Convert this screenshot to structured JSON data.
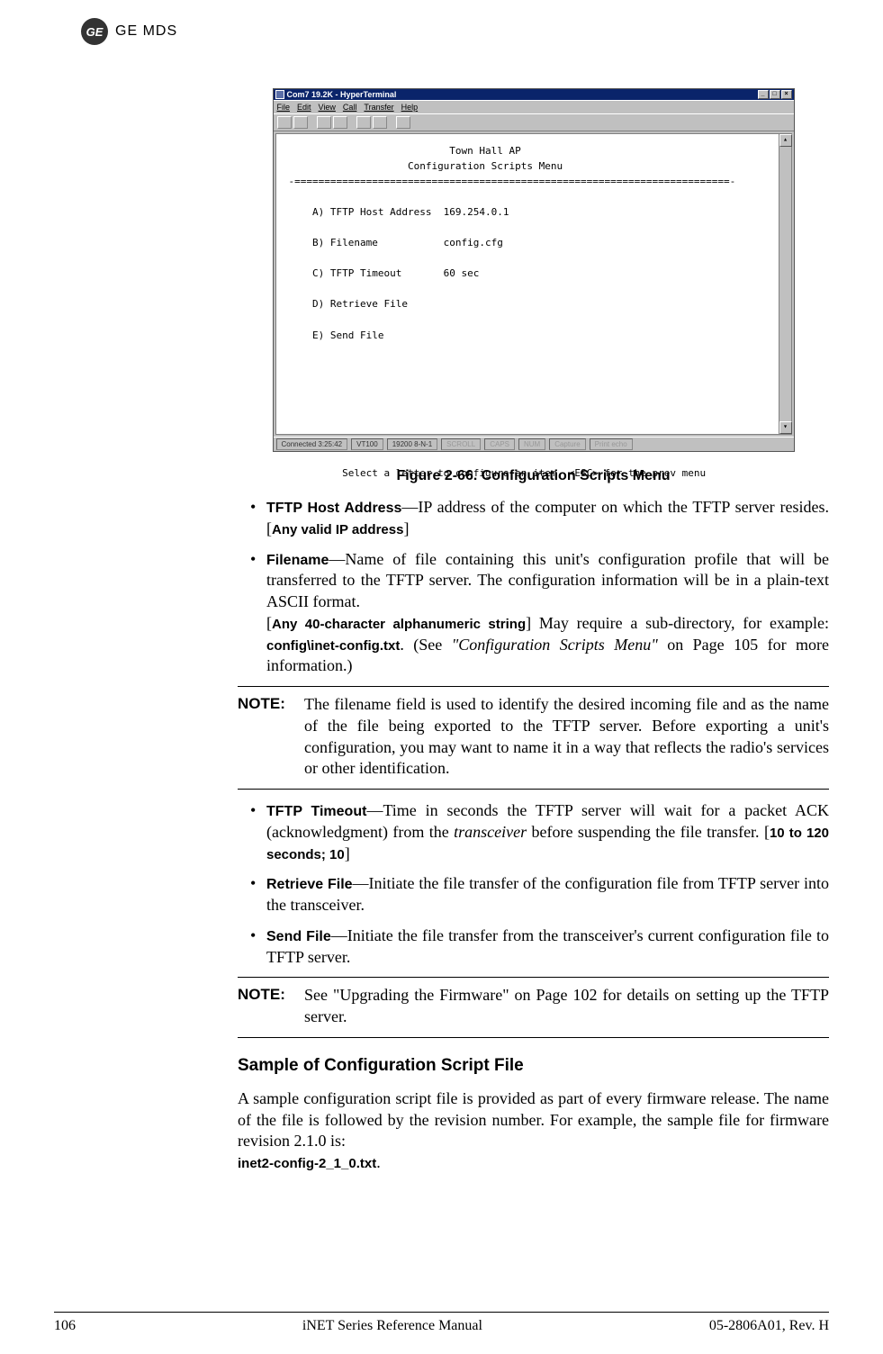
{
  "brand": {
    "ge": "GE",
    "mds": "MDS"
  },
  "screenshot": {
    "title": "Com7 19.2K - HyperTerminal",
    "menu": {
      "file": "File",
      "edit": "Edit",
      "view": "View",
      "call": "Call",
      "transfer": "Transfer",
      "help": "Help"
    },
    "terminal_text": "                           Town Hall AP\n                    Configuration Scripts Menu\n-=========================================================================-\n\n    A) TFTP Host Address  169.254.0.1\n\n    B) Filename           config.cfg\n\n    C) TFTP Timeout       60 sec\n\n    D) Retrieve File\n\n    E) Send File\n\n\n\n\n\n\n\n\n         Select a letter to configure an item, <ESC> for the prev menu",
    "status": {
      "conn": "Connected 3:25:42",
      "emu": "VT100",
      "speed": "19200 8-N-1",
      "scroll": "SCROLL",
      "caps": "CAPS",
      "num": "NUM",
      "capture": "Capture",
      "echo": "Print echo"
    }
  },
  "figure_caption": "Figure 2-66. Configuration Scripts Menu",
  "bullets1": {
    "b1_label": "TFTP Host Address",
    "b1_text": "—IP address of the computer on which the TFTP server resides. [",
    "b1_val": "Any valid IP address",
    "b1_end": "]",
    "b2_label": "Filename",
    "b2_text1": "—Name of file containing this unit's configuration profile that will be transferred to the TFTP server. The configuration information will be in a plain-text ASCII format.",
    "b2_br_open": "[",
    "b2_val": "Any 40-character alphanumeric string",
    "b2_text2": "] May require a sub-directory, for example: ",
    "b2_code": "config\\inet-config.txt",
    "b2_text3": ". (See ",
    "b2_quote": "\"Configuration Scripts Menu\"",
    "b2_text4": " on Page 105 for more information.)"
  },
  "note1": {
    "label": "NOTE:",
    "text": "The filename field is used to identify the desired incoming file and as the name of the file being exported to the TFTP server. Before exporting a unit's configuration, you may want to name it in a way that reflects the radio's services or other identification."
  },
  "bullets2": {
    "b3_label": "TFTP Timeout",
    "b3_text1": "—Time in seconds the TFTP server will wait for a packet ACK (acknowledgment) from the ",
    "b3_ital": "transceiver",
    "b3_text2": " before suspending the file transfer. [",
    "b3_val": "10 to 120 seconds; 10",
    "b3_end": "]",
    "b4_label": "Retrieve File",
    "b4_text": "—Initiate the file transfer of the configuration file from TFTP server into the transceiver.",
    "b5_label": "Send File",
    "b5_text": "—Initiate the file transfer from the transceiver's current configuration file to TFTP server."
  },
  "note2": {
    "label": "NOTE:",
    "text": "See \"Upgrading the Firmware\" on Page 102 for details on setting up the TFTP server."
  },
  "subhead": "Sample of Configuration Script File",
  "para": {
    "text": "A sample configuration script file is provided as part of every firmware release. The name of the file is followed by the revision number. For example, the sample file for firmware revision 2.1.0 is:",
    "code": "inet2-config-2_1_0.txt",
    "end": "."
  },
  "footer": {
    "page": "106",
    "title": "iNET Series Reference Manual",
    "rev": "05-2806A01, Rev. H"
  }
}
